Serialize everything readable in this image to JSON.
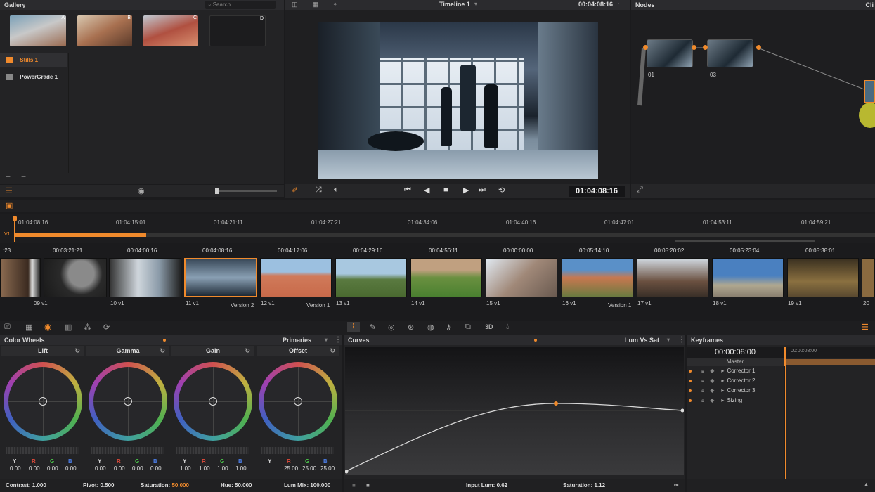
{
  "gallery": {
    "title": "Gallery",
    "search_placeholder": "Search",
    "stills": [
      {
        "tag": "A"
      },
      {
        "tag": "B"
      },
      {
        "tag": "C"
      },
      {
        "tag": "D"
      }
    ],
    "albums": [
      {
        "label": "Stills 1"
      },
      {
        "label": "PowerGrade 1"
      }
    ],
    "add": "+",
    "remove": "−"
  },
  "viewer": {
    "timeline_name": "Timeline 1",
    "source_timecode": "00:04:08:16",
    "current_timecode": "01:04:08:16"
  },
  "nodes": {
    "title": "Nodes",
    "clip_tab": "Cli",
    "items": [
      {
        "label": "01"
      },
      {
        "label": "03"
      }
    ]
  },
  "timeline": {
    "track": "V1",
    "ruler": [
      "01:04:08:16",
      "01:04:15:01",
      "01:04:21:11",
      "01:04:27:21",
      "01:04:34:06",
      "01:04:40:16",
      "01:04:47:01",
      "01:04:53:11",
      "01:04:59:21"
    ],
    "clip_timecodes": [
      ":23",
      "00:03:21:21",
      "00:04:00:16",
      "00:04:08:16",
      "00:04:17:06",
      "00:04:29:16",
      "00:04:56:11",
      "00:00:00:00",
      "00:05:14:10",
      "00:05:20:02",
      "00:05:23:04",
      "00:05:38:01"
    ],
    "clips": [
      {
        "num": "09",
        "track": "V1",
        "version": ""
      },
      {
        "num": "10",
        "track": "V1",
        "version": ""
      },
      {
        "num": "11",
        "track": "V1",
        "version": "Version 2"
      },
      {
        "num": "12",
        "track": "V1",
        "version": "Version 1"
      },
      {
        "num": "13",
        "track": "V1",
        "version": ""
      },
      {
        "num": "14",
        "track": "V1",
        "version": ""
      },
      {
        "num": "15",
        "track": "V1",
        "version": ""
      },
      {
        "num": "16",
        "track": "V1",
        "version": "Version 1"
      },
      {
        "num": "17",
        "track": "V1",
        "version": ""
      },
      {
        "num": "18",
        "track": "V1",
        "version": ""
      },
      {
        "num": "19",
        "track": "V1",
        "version": ""
      },
      {
        "num": "20",
        "track": "",
        "version": ""
      }
    ]
  },
  "color_wheels": {
    "title": "Color Wheels",
    "mode": "Primaries",
    "wheels": [
      {
        "name": "Lift",
        "y": "0.00",
        "r": "0.00",
        "g": "0.00",
        "b": "0.00"
      },
      {
        "name": "Gamma",
        "y": "0.00",
        "r": "0.00",
        "g": "0.00",
        "b": "0.00"
      },
      {
        "name": "Gain",
        "y": "1.00",
        "r": "1.00",
        "g": "1.00",
        "b": "1.00"
      },
      {
        "name": "Offset",
        "y": "",
        "r": "25.00",
        "g": "25.00",
        "b": "25.00"
      }
    ],
    "channel_labels": {
      "y": "Y",
      "r": "R",
      "g": "G",
      "b": "B"
    },
    "footer": {
      "contrast_label": "Contrast:",
      "contrast": "1.000",
      "pivot_label": "Pivot:",
      "pivot": "0.500",
      "saturation_label": "Saturation:",
      "saturation": "50.000",
      "hue_label": "Hue:",
      "hue": "50.000",
      "lum_mix_label": "Lum Mix:",
      "lum_mix": "100.000"
    }
  },
  "curves": {
    "title": "Curves",
    "mode": "Lum Vs Sat",
    "input_lum_label": "Input Lum:",
    "input_lum": "0.62",
    "saturation_label": "Saturation:",
    "saturation": "1.12"
  },
  "keyframes": {
    "title": "Keyframes",
    "timecode": "00:00:08:00",
    "ruler_timecode": "00:00:08:00",
    "master": "Master",
    "rows": [
      {
        "label": "Corrector 1"
      },
      {
        "label": "Corrector 2"
      },
      {
        "label": "Corrector 3"
      },
      {
        "label": "Sizing"
      }
    ]
  },
  "page_tab_3d": "3D",
  "colors": {
    "accent": "#f08a2c",
    "panel": "#232325",
    "bg": "#1b1b1d"
  }
}
